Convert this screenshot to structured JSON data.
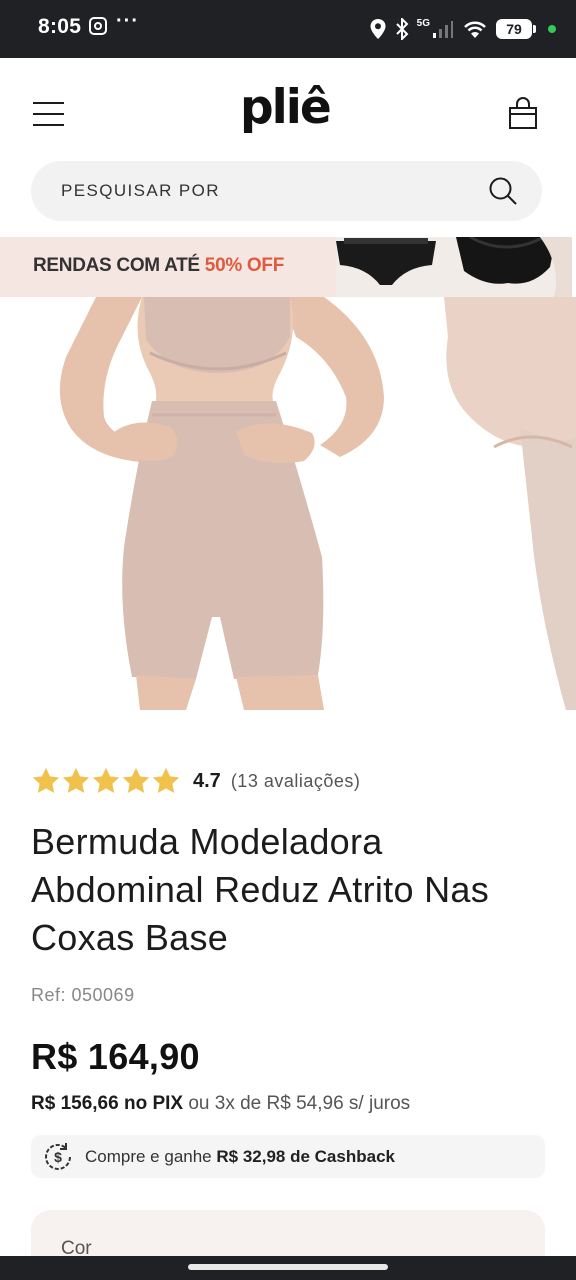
{
  "status_bar": {
    "time": "8:05",
    "network": "5G",
    "battery": "79"
  },
  "header": {
    "logo": "pliê"
  },
  "search": {
    "placeholder": "PESQUISAR POR"
  },
  "promo": {
    "text": "RENDAS COM ATÉ",
    "highlight": "50% OFF"
  },
  "product": {
    "rating_value": "4.7",
    "rating_count": "(13 avaliações)",
    "rating_stars": 5,
    "title": "Bermuda Modeladora Abdominal Reduz Atrito Nas Coxas Base",
    "ref": "Ref: 050069",
    "price": "R$ 164,90",
    "pix_price": "R$ 156,66 no PIX",
    "installments": "ou 3x de R$ 54,96 s/ juros",
    "cashback_text": "Compre e ganhe",
    "cashback_value": "R$ 32,98 de Cashback",
    "color_label": "Cor"
  },
  "colors": {
    "accent": "#e05a3f",
    "star": "#f0c14b",
    "promo_bg": "#f5e6e1",
    "skin_tone": "#d8bdb3"
  }
}
